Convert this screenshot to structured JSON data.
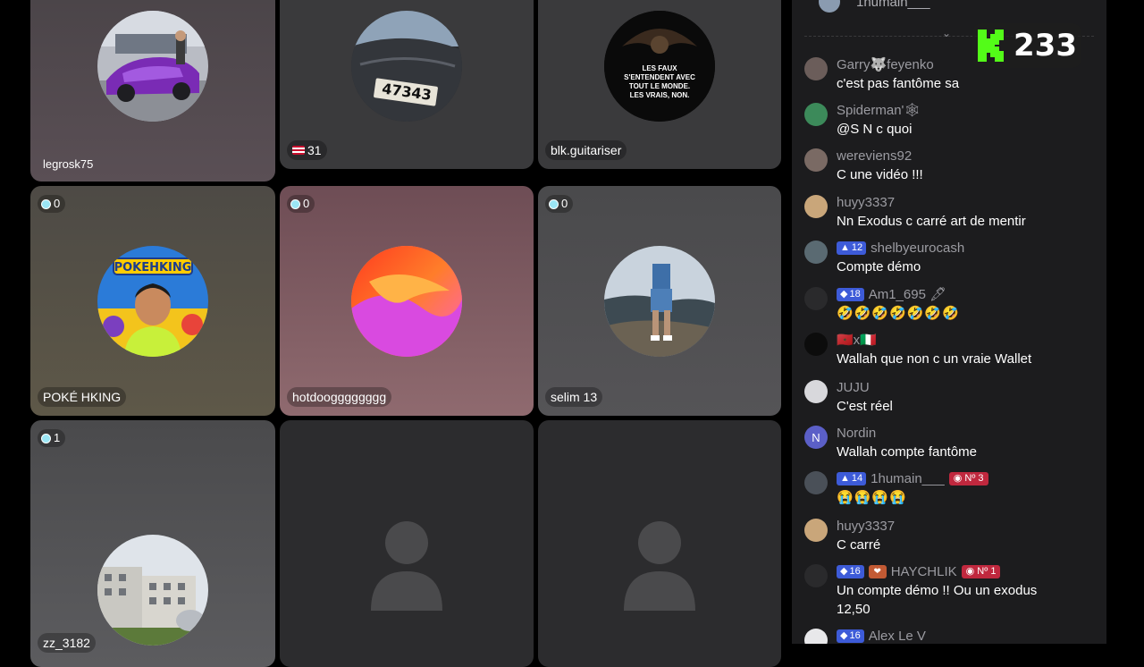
{
  "viewer_count": "233",
  "guests": [
    {
      "name": "legrosk75",
      "score": null
    },
    {
      "name": "31",
      "score": null,
      "flag": true
    },
    {
      "name": "blk.guitariser",
      "score": null,
      "avatar_text": [
        "LES FAUX",
        "S'ENTENDENT AVEC",
        "TOUT LE MONDE.",
        "LES VRAIS, NON."
      ]
    },
    {
      "name": "POKÉ HKING",
      "score": "0",
      "avatar_text": [
        "POKEHKING"
      ]
    },
    {
      "name": "hotdoogggggggg",
      "score": "0"
    },
    {
      "name": "selim 13",
      "score": "0"
    },
    {
      "name": "zz_3182",
      "score": "1"
    },
    {
      "name": "",
      "score": null
    },
    {
      "name": "",
      "score": null
    }
  ],
  "car_plate": "47343",
  "chat": {
    "top_user": "1humain___",
    "messages": [
      {
        "user": "Garry🐺feyenko",
        "text": "c'est pas fantôme sa",
        "avatar": "",
        "level": null
      },
      {
        "user": "Spiderman'🕸",
        "text": "@S N c quoi",
        "avatar": "",
        "level": null
      },
      {
        "user": "wereviens92",
        "text": "C une vidéo !!!",
        "avatar": "",
        "level": null
      },
      {
        "user": "huyy3337",
        "text": "Nn Exodus c carré art de mentir",
        "avatar": "",
        "level": null
      },
      {
        "user": "shelbyeurocash",
        "text": "Compte démo",
        "avatar": "",
        "level": "12"
      },
      {
        "user": "Am1_695 🖋",
        "text": "🤣🤣🤣🤣🤣🤣🤣",
        "avatar": "",
        "level": "18"
      },
      {
        "user": "🇲🇦x🇮🇹",
        "text": "Wallah que non c un vraie Wallet",
        "avatar": "",
        "level": null
      },
      {
        "user": "JUJU",
        "text": "C'est réel",
        "avatar": "",
        "level": null
      },
      {
        "user": "Nordin",
        "text": "Wallah compte fantôme",
        "avatar": "N",
        "level": null
      },
      {
        "user": "1humain___",
        "text": "😭😭😭😭",
        "avatar": "",
        "level": "14",
        "rank": "Nº 3"
      },
      {
        "user": "huyy3337",
        "text": "C carré",
        "avatar": "",
        "level": null
      },
      {
        "user": "HAYCHLIK",
        "text": "Un compte démo !! Ou un exodus 12,50",
        "avatar": "",
        "level": "16",
        "rank": "Nº 1",
        "heart": true
      },
      {
        "user": "Alex Le V",
        "text": "",
        "avatar": "",
        "level": "16"
      }
    ]
  },
  "colors": {
    "accent_green": "#53fc18",
    "level_blue": "#3d5bd8",
    "rank_red": "#c0283e",
    "chat_bg": "#1c1c1e"
  }
}
